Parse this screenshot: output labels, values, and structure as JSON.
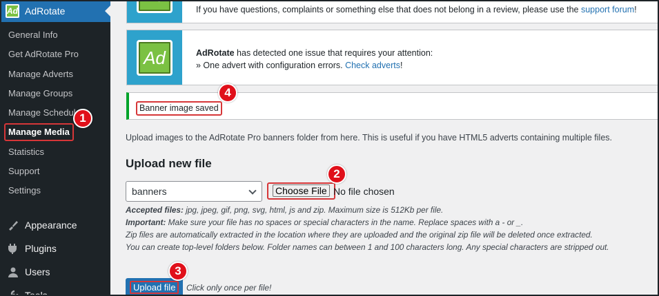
{
  "sidebar": {
    "plugin_name": "AdRotate",
    "plugin_logo": "Ad",
    "submenu": [
      {
        "label": "General Info"
      },
      {
        "label": "Get AdRotate Pro"
      },
      {
        "label": "Manage Adverts"
      },
      {
        "label": "Manage Groups"
      },
      {
        "label": "Manage Schedules"
      },
      {
        "label": "Manage Media"
      },
      {
        "label": "Statistics"
      },
      {
        "label": "Support"
      },
      {
        "label": "Settings"
      }
    ],
    "menu": [
      {
        "label": "Appearance",
        "icon": "appearance-icon"
      },
      {
        "label": "Plugins",
        "icon": "plugins-icon"
      },
      {
        "label": "Users",
        "icon": "users-icon"
      },
      {
        "label": "Tools",
        "icon": "tools-icon"
      }
    ]
  },
  "notices": {
    "review": {
      "icon_text": "Ad",
      "text": "If you have questions, complaints or something else that does not belong in a review, please use the ",
      "link": "support forum",
      "suffix": "!"
    },
    "issue": {
      "icon_text": "Ad",
      "brand": "AdRotate",
      "line1": " has detected one issue that requires your attention:",
      "line2": "» One advert with configuration errors. ",
      "link": "Check adverts",
      "suffix": "!"
    },
    "success": "Banner image saved"
  },
  "main": {
    "intro": "Upload images to the AdRotate Pro banners folder from here. This is useful if you have HTML5 adverts containing multiple files.",
    "heading": "Upload new file",
    "folder_select": "banners",
    "choose_file_label": "Choose File",
    "no_file_text": "No file chosen",
    "help": {
      "accepted_label": "Accepted files:",
      "accepted_text": " jpg, jpeg, gif, png, svg, html, js and zip. Maximum size is 512Kb per file.",
      "important_label": "Important:",
      "important_text": " Make sure your file has no spaces or special characters in the name. Replace spaces with a - or _.",
      "zip_text": "Zip files are automatically extracted in the location where they are uploaded and the original zip file will be deleted once extracted.",
      "folders_text": "You can create top-level folders below. Folder names can between 1 and 100 characters long. Any special characters are stripped out."
    },
    "upload_label": "Upload file",
    "upload_hint": "Click only once per file!"
  },
  "markers": [
    "1",
    "2",
    "3",
    "4"
  ],
  "colors": {
    "sidebar_bg": "#1d2327",
    "accent": "#2271b1",
    "success": "#00a32a",
    "highlight": "#d63638",
    "marker": "#e0101a",
    "ad_green": "#7bc143",
    "notice_blue": "#2ea2cc"
  }
}
